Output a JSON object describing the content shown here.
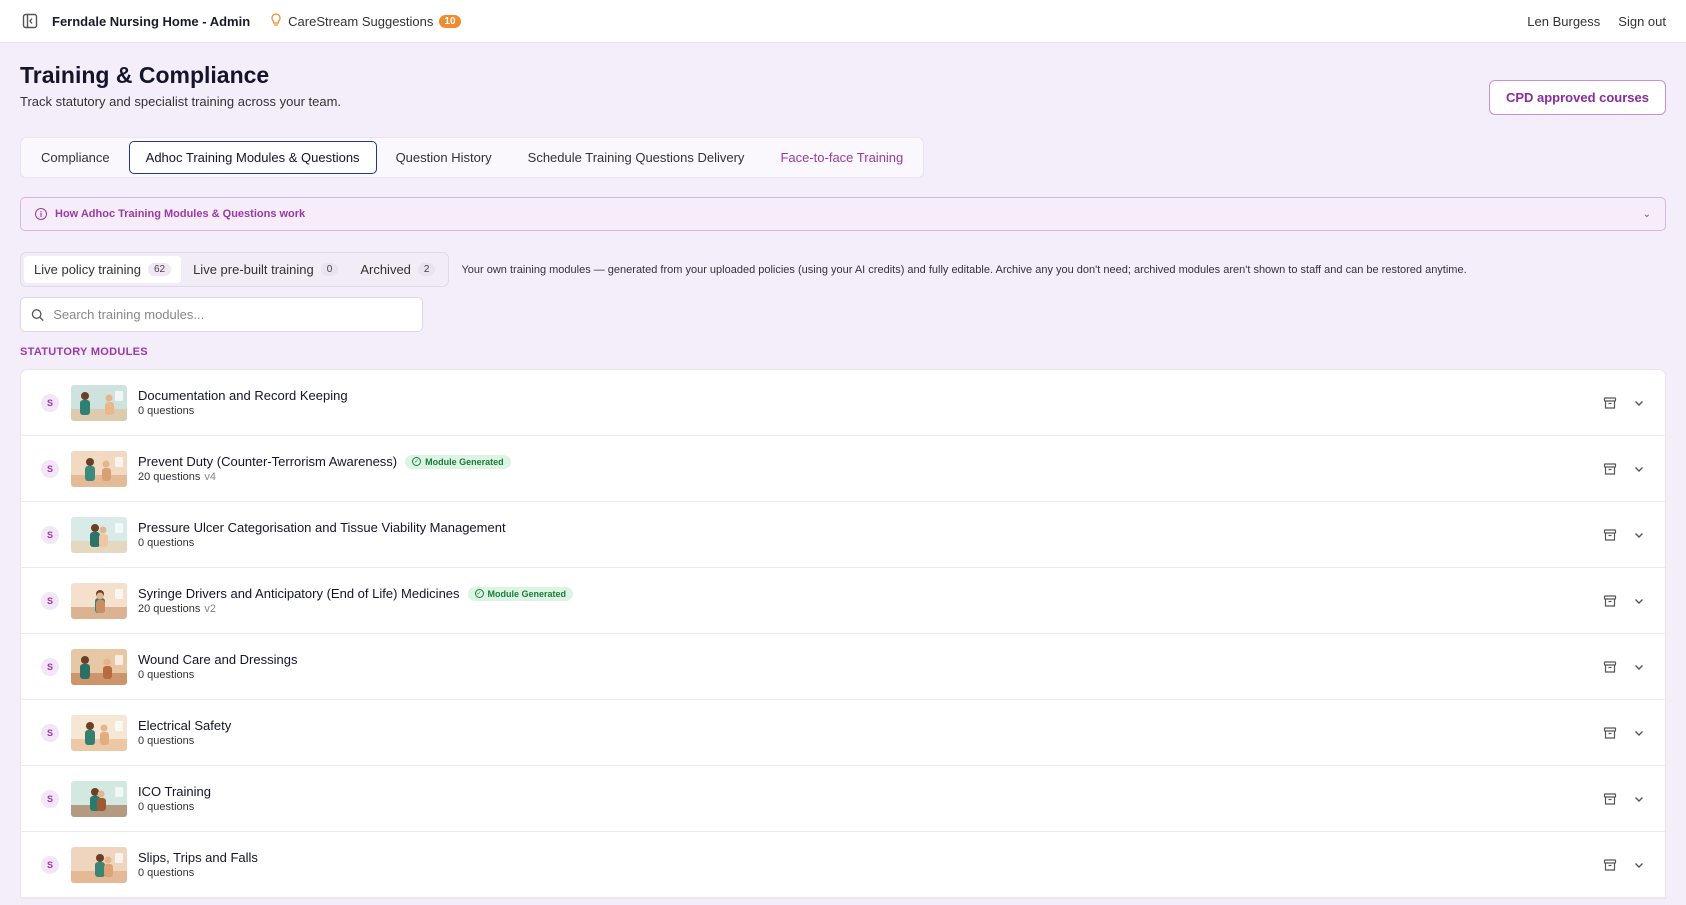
{
  "topbar": {
    "app_title": "Ferndale Nursing Home - Admin",
    "suggestions_label": "CareStream Suggestions",
    "suggestions_count": "10",
    "user_name": "Len Burgess",
    "sign_out": "Sign out"
  },
  "page": {
    "title": "Training & Compliance",
    "subtitle": "Track statutory and specialist training across your team.",
    "cpd_button": "CPD approved courses"
  },
  "tabs": [
    {
      "label": "Compliance"
    },
    {
      "label": "Adhoc Training Modules & Questions"
    },
    {
      "label": "Question History"
    },
    {
      "label": "Schedule Training Questions Delivery"
    },
    {
      "label": "Face-to-face Training"
    }
  ],
  "info_box": {
    "label": "How Adhoc Training Modules & Questions work"
  },
  "subtabs": [
    {
      "label": "Live policy training",
      "count": "62"
    },
    {
      "label": "Live pre-built training",
      "count": "0"
    },
    {
      "label": "Archived",
      "count": "2"
    }
  ],
  "subtabs_description": "Your own training modules — generated from your uploaded policies (using your AI credits) and fully editable. Archive any you don't need; archived modules aren't shown to staff and can be restored anytime.",
  "search": {
    "placeholder": "Search training modules..."
  },
  "section_title": "STATUTORY MODULES",
  "generated_badge": "Module Generated",
  "modules": [
    {
      "badge": "S",
      "title": "Documentation and Record Keeping",
      "questions": "0 questions",
      "version": ""
    },
    {
      "badge": "S",
      "title": "Prevent Duty (Counter-Terrorism Awareness)",
      "questions": "20 questions",
      "version": "v4"
    },
    {
      "badge": "S",
      "title": "Pressure Ulcer Categorisation and Tissue Viability Management",
      "questions": "0 questions",
      "version": ""
    },
    {
      "badge": "S",
      "title": "Syringe Drivers and Anticipatory (End of Life) Medicines",
      "questions": "20 questions",
      "version": "v2"
    },
    {
      "badge": "S",
      "title": "Wound Care and Dressings",
      "questions": "0 questions",
      "version": ""
    },
    {
      "badge": "S",
      "title": "Electrical Safety",
      "questions": "0 questions",
      "version": ""
    },
    {
      "badge": "S",
      "title": "ICO Training",
      "questions": "0 questions",
      "version": ""
    },
    {
      "badge": "S",
      "title": "Slips, Trips and Falls",
      "questions": "0 questions",
      "version": ""
    }
  ]
}
